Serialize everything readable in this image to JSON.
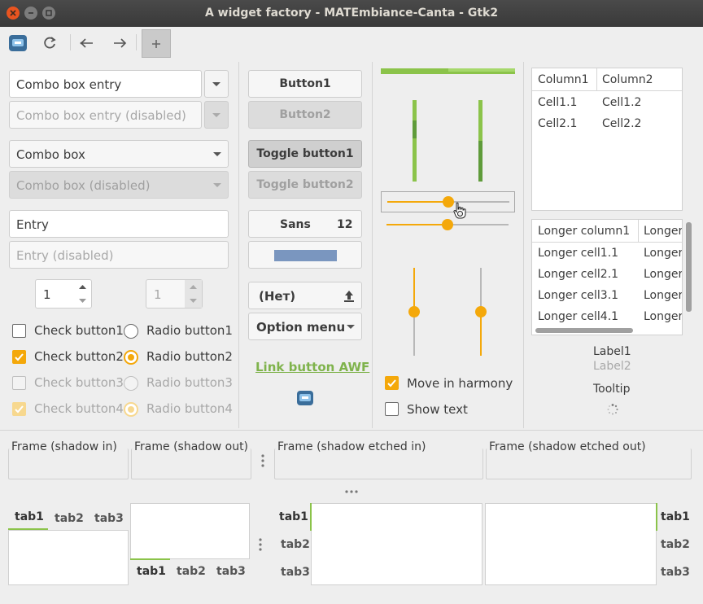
{
  "window": {
    "title": "A widget factory - MATEmbiance-Canta - Gtk2"
  },
  "colors": {
    "accent": "#f4a80a",
    "green": "#8bc34a",
    "green_dark": "#5f9b3a",
    "titlebar": "#3c3c3c",
    "close": "#e95420"
  },
  "toolbar": {
    "icons": [
      "app-icon",
      "refresh-icon",
      "back-icon",
      "forward-icon",
      "add-icon"
    ]
  },
  "left": {
    "combo_entry": "Combo box entry",
    "combo_entry_disabled": "Combo box entry (disabled)",
    "combo_box": "Combo box",
    "combo_box_disabled": "Combo box (disabled)",
    "entry": "Entry",
    "entry_disabled_placeholder": "Entry (disabled)",
    "spin1": "1",
    "spin2": "1",
    "check1": "Check button1",
    "check2": "Check button2",
    "check3": "Check button3",
    "check4": "Check button4",
    "radio1": "Radio button1",
    "radio2": "Radio button2",
    "radio3": "Radio button3",
    "radio4": "Radio button4"
  },
  "middle": {
    "button1": "Button1",
    "button2": "Button2",
    "toggle1": "Toggle button1",
    "toggle2": "Toggle button2",
    "font_name": "Sans",
    "font_size": "12",
    "file_chooser": "(Нет)",
    "option_menu": "Option menu",
    "link": "Link button AWF"
  },
  "scales": {
    "progress_fraction": 0.5,
    "hscale1_fraction": 0.5,
    "hscale2_fraction": 0.5,
    "vscale1_fraction": 0.5,
    "vscale2_fraction": 0.5,
    "move_in_harmony": "Move in harmony",
    "show_text": "Show text"
  },
  "tree1": {
    "columns": [
      "Column1",
      "Column2"
    ],
    "rows": [
      [
        "Cell1.1",
        "Cell1.2"
      ],
      [
        "Cell2.1",
        "Cell2.2"
      ]
    ]
  },
  "tree2": {
    "columns": [
      "Longer column1",
      "Longer"
    ],
    "rows": [
      [
        "Longer cell1.1",
        "Longer"
      ],
      [
        "Longer cell2.1",
        "Longer"
      ],
      [
        "Longer cell3.1",
        "Longer"
      ],
      [
        "Longer cell4.1",
        "Longer"
      ]
    ]
  },
  "right_labels": {
    "label1": "Label1",
    "label2": "Label2",
    "tooltip": "Tooltip"
  },
  "frames": {
    "f1": "Frame (shadow in)",
    "f2": "Frame (shadow out)",
    "f3": "Frame (shadow etched in)",
    "f4": "Frame (shadow etched out)"
  },
  "tabs": {
    "t1": "tab1",
    "t2": "tab2",
    "t3": "tab3"
  }
}
